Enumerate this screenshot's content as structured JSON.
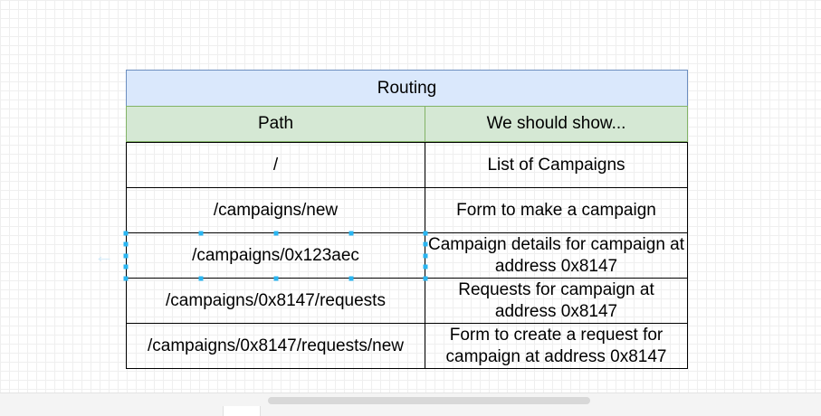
{
  "table": {
    "title": "Routing",
    "headers": [
      "Path",
      "We should show..."
    ],
    "rows": [
      {
        "path": "/",
        "show": "List of Campaigns"
      },
      {
        "path": "/campaigns/new",
        "show": "Form to make a campaign"
      },
      {
        "path": "/campaigns/0x123aec",
        "show": "Campaign details for campaign at address 0x8147"
      },
      {
        "path": "/campaigns/0x8147/requests",
        "show": "Requests for campaign at address 0x8147"
      },
      {
        "path": "/campaigns/0x8147/requests/new",
        "show": "Form to create a request for campaign at address 0x8147"
      }
    ]
  },
  "colors": {
    "title_fill": "#dae8fc",
    "title_stroke": "#6c8ebf",
    "header_fill": "#d5e8d4",
    "header_stroke": "#82b366",
    "selection": "#29b6f2"
  },
  "icons": {
    "connection_hint": "arrow-left-icon"
  }
}
